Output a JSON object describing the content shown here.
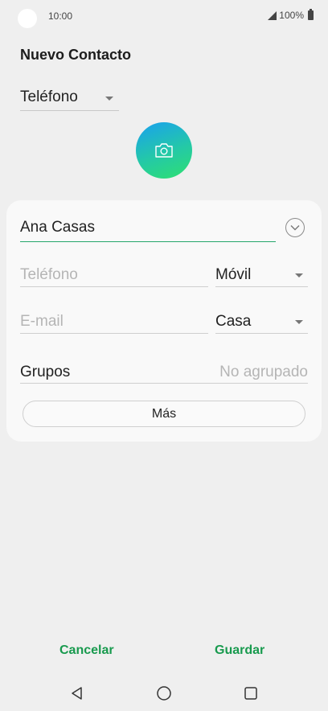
{
  "status_bar": {
    "time": "10:00",
    "battery": "100%",
    "icons": [
      "signal-icon",
      "battery-icon"
    ]
  },
  "header": {
    "title": "Nuevo Contacto"
  },
  "account": {
    "selected": "Teléfono"
  },
  "photo": {
    "icon": "camera-icon"
  },
  "form": {
    "name_value": "Ana Casas",
    "phone_placeholder": "Teléfono",
    "phone_type": "Móvil",
    "email_placeholder": "E-mail",
    "email_type": "Casa",
    "groups_label": "Grupos",
    "groups_value": "No agrupado",
    "more_label": "Más"
  },
  "actions": {
    "cancel_label": "Cancelar",
    "save_label": "Guardar"
  },
  "colors": {
    "accent": "#189a4e",
    "background": "#efefef",
    "card": "#f9f9f9"
  }
}
